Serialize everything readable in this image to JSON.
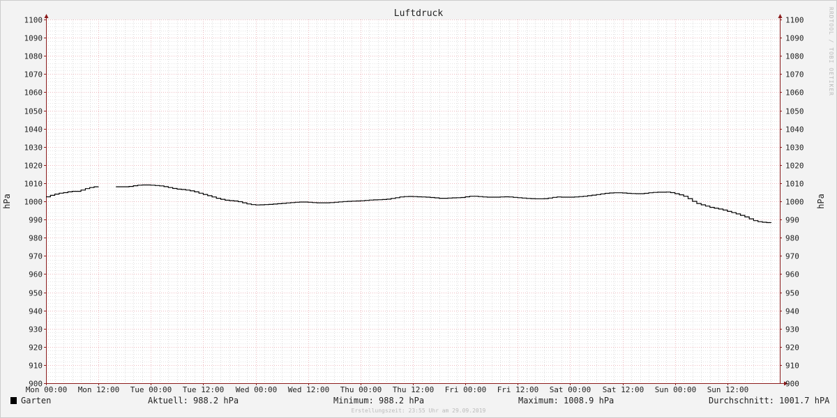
{
  "chart_data": {
    "type": "line",
    "title": "Luftdruck",
    "ylabel": "hPa",
    "ylabel_right": "hPa",
    "ylim": [
      900,
      1100
    ],
    "y_ticks": [
      900,
      910,
      920,
      930,
      940,
      950,
      960,
      970,
      980,
      990,
      1000,
      1010,
      1020,
      1030,
      1040,
      1050,
      1060,
      1070,
      1080,
      1090,
      1100
    ],
    "xlim_hours": [
      0,
      168
    ],
    "x_ticks": [
      {
        "label": "Mon 00:00",
        "hour": 0
      },
      {
        "label": "Mon 12:00",
        "hour": 12
      },
      {
        "label": "Tue 00:00",
        "hour": 24
      },
      {
        "label": "Tue 12:00",
        "hour": 36
      },
      {
        "label": "Wed 00:00",
        "hour": 48
      },
      {
        "label": "Wed 12:00",
        "hour": 60
      },
      {
        "label": "Thu 00:00",
        "hour": 72
      },
      {
        "label": "Thu 12:00",
        "hour": 84
      },
      {
        "label": "Fri 00:00",
        "hour": 96
      },
      {
        "label": "Fri 12:00",
        "hour": 108
      },
      {
        "label": "Sat 00:00",
        "hour": 120
      },
      {
        "label": "Sat 12:00",
        "hour": 132
      },
      {
        "label": "Sun 00:00",
        "hour": 144
      },
      {
        "label": "Sun 12:00",
        "hour": 156
      }
    ],
    "grid": true,
    "series": [
      {
        "name": "Garten",
        "color": "#000000",
        "segments": [
          [
            [
              0,
              1002.5
            ],
            [
              1,
              1003.3
            ],
            [
              2,
              1004
            ],
            [
              3,
              1004.5
            ],
            [
              4,
              1004.8
            ],
            [
              5,
              1005.2
            ],
            [
              6,
              1005.5
            ],
            [
              7,
              1005.5
            ],
            [
              8,
              1006.2
            ],
            [
              9,
              1007
            ],
            [
              10,
              1007.6
            ],
            [
              11,
              1008
            ],
            [
              12,
              1008.1
            ]
          ],
          [
            [
              16,
              1008
            ],
            [
              17,
              1008
            ],
            [
              18,
              1008
            ],
            [
              19,
              1008.2
            ],
            [
              20,
              1008.6
            ],
            [
              21,
              1008.9
            ],
            [
              22,
              1009
            ],
            [
              23,
              1009
            ],
            [
              24,
              1008.9
            ],
            [
              25,
              1008.7
            ],
            [
              26,
              1008.5
            ],
            [
              27,
              1008.1
            ],
            [
              28,
              1007.6
            ],
            [
              29,
              1007.1
            ],
            [
              30,
              1006.7
            ],
            [
              31,
              1006.5
            ],
            [
              32,
              1006.2
            ],
            [
              33,
              1005.8
            ],
            [
              34,
              1005.2
            ],
            [
              35,
              1004.5
            ],
            [
              36,
              1003.8
            ],
            [
              37,
              1003.1
            ],
            [
              38,
              1002.4
            ],
            [
              39,
              1001.7
            ],
            [
              40,
              1001.1
            ],
            [
              41,
              1000.6
            ],
            [
              42,
              1000.4
            ],
            [
              43,
              1000.2
            ],
            [
              44,
              999.8
            ],
            [
              45,
              999.2
            ],
            [
              46,
              998.6
            ],
            [
              47,
              998.2
            ],
            [
              48,
              998
            ],
            [
              49,
              998.1
            ],
            [
              50,
              998.2
            ],
            [
              51,
              998.3
            ],
            [
              52,
              998.5
            ],
            [
              53,
              998.7
            ],
            [
              54,
              998.9
            ],
            [
              55,
              999.1
            ],
            [
              56,
              999.3
            ],
            [
              57,
              999.5
            ],
            [
              58,
              999.6
            ],
            [
              59,
              999.6
            ],
            [
              60,
              999.5
            ],
            [
              61,
              999.3
            ],
            [
              62,
              999.2
            ],
            [
              63,
              999.2
            ],
            [
              64,
              999.2
            ],
            [
              65,
              999.3
            ],
            [
              66,
              999.5
            ],
            [
              67,
              999.7
            ],
            [
              68,
              999.9
            ],
            [
              69,
              1000
            ],
            [
              70,
              1000.1
            ],
            [
              71,
              1000.2
            ],
            [
              72,
              1000.3
            ],
            [
              73,
              1000.5
            ],
            [
              74,
              1000.7
            ],
            [
              75,
              1000.8
            ],
            [
              76,
              1000.9
            ],
            [
              77,
              1001
            ],
            [
              78,
              1001.2
            ],
            [
              79,
              1001.6
            ],
            [
              80,
              1002
            ],
            [
              81,
              1002.4
            ],
            [
              82,
              1002.6
            ],
            [
              83,
              1002.7
            ],
            [
              84,
              1002.6
            ],
            [
              85,
              1002.5
            ],
            [
              86,
              1002.4
            ],
            [
              87,
              1002.3
            ],
            [
              88,
              1002.1
            ],
            [
              89,
              1001.9
            ],
            [
              90,
              1001.7
            ],
            [
              91,
              1001.7
            ],
            [
              92,
              1001.8
            ],
            [
              93,
              1001.9
            ],
            [
              94,
              1002
            ],
            [
              95,
              1002.1
            ],
            [
              96,
              1002.5
            ],
            [
              97,
              1002.8
            ],
            [
              98,
              1002.8
            ],
            [
              99,
              1002.6
            ],
            [
              100,
              1002.4
            ],
            [
              101,
              1002.3
            ],
            [
              102,
              1002.3
            ],
            [
              103,
              1002.3
            ],
            [
              104,
              1002.4
            ],
            [
              105,
              1002.5
            ],
            [
              106,
              1002.4
            ],
            [
              107,
              1002.2
            ],
            [
              108,
              1002
            ],
            [
              109,
              1001.8
            ],
            [
              110,
              1001.6
            ],
            [
              111,
              1001.5
            ],
            [
              112,
              1001.4
            ],
            [
              113,
              1001.4
            ],
            [
              114,
              1001.5
            ],
            [
              115,
              1001.8
            ],
            [
              116,
              1002.2
            ],
            [
              117,
              1002.4
            ],
            [
              118,
              1002.3
            ],
            [
              119,
              1002.3
            ],
            [
              120,
              1002.3
            ],
            [
              121,
              1002.4
            ],
            [
              122,
              1002.6
            ],
            [
              123,
              1002.8
            ],
            [
              124,
              1003.1
            ],
            [
              125,
              1003.4
            ],
            [
              126,
              1003.7
            ],
            [
              127,
              1004.1
            ],
            [
              128,
              1004.4
            ],
            [
              129,
              1004.6
            ],
            [
              130,
              1004.7
            ],
            [
              131,
              1004.7
            ],
            [
              132,
              1004.6
            ],
            [
              133,
              1004.4
            ],
            [
              134,
              1004.3
            ],
            [
              135,
              1004.2
            ],
            [
              136,
              1004.2
            ],
            [
              137,
              1004.4
            ],
            [
              138,
              1004.7
            ],
            [
              139,
              1004.9
            ],
            [
              140,
              1005
            ],
            [
              141,
              1005
            ],
            [
              142,
              1005.1
            ],
            [
              143,
              1004.8
            ],
            [
              144,
              1004.2
            ],
            [
              145,
              1003.6
            ],
            [
              146,
              1002.8
            ],
            [
              147,
              1001.5
            ],
            [
              148,
              1000
            ],
            [
              149,
              998.8
            ],
            [
              150,
              998.1
            ],
            [
              151,
              997.4
            ],
            [
              152,
              996.7
            ],
            [
              153,
              996.2
            ],
            [
              154,
              995.8
            ],
            [
              155,
              995.2
            ],
            [
              156,
              994.5
            ],
            [
              157,
              993.8
            ],
            [
              158,
              993.1
            ],
            [
              159,
              992.3
            ],
            [
              160,
              991.4
            ],
            [
              161,
              990.4
            ],
            [
              162,
              989.4
            ],
            [
              163,
              988.8
            ],
            [
              164,
              988.5
            ],
            [
              165,
              988.3
            ],
            [
              166,
              988.2
            ]
          ]
        ]
      }
    ]
  },
  "legend": {
    "series_name": "Garten",
    "series_color": "#000000",
    "aktuell": "Aktuell: 988.2 hPa",
    "minimum": "Minimum: 988.2 hPa",
    "maximum": "Maximum: 1008.9 hPa",
    "durchschnitt": "Durchschnitt: 1001.7 hPA"
  },
  "footer": {
    "erstellungszeit": "Erstellungszeit: 23:55 Uhr am 29.09.2019"
  },
  "watermark": "RRDTOOL / TOBI OETIKER",
  "colors": {
    "background": "#f3f3f3",
    "plot_background": "#ffffff",
    "major_grid": "#e8a0a8",
    "minor_grid": "#c8c8c8",
    "axis": "#8b1a1a",
    "line": "#000000"
  }
}
